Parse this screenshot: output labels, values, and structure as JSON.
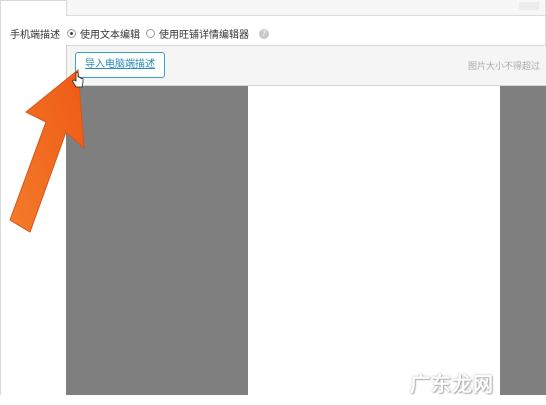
{
  "form": {
    "row_label": "手机端描述",
    "options": [
      {
        "label": "使用文本编辑",
        "checked": true
      },
      {
        "label": "使用旺铺详情编辑器",
        "checked": false
      }
    ],
    "help_icon_glyph": "?"
  },
  "editor": {
    "import_button_label": "导入电脑端描述",
    "size_hint": "图片大小不得超过"
  },
  "watermark": {
    "text": "广东龙网"
  },
  "colors": {
    "arrow": "#f26522",
    "canvas_gray": "#7f7f7f",
    "button_border": "#37a6c0",
    "link": "#2a8bb3"
  },
  "icons": {
    "arrow": "orange-pointer-arrow",
    "cursor": "hand-cursor-icon",
    "help": "help-icon"
  }
}
